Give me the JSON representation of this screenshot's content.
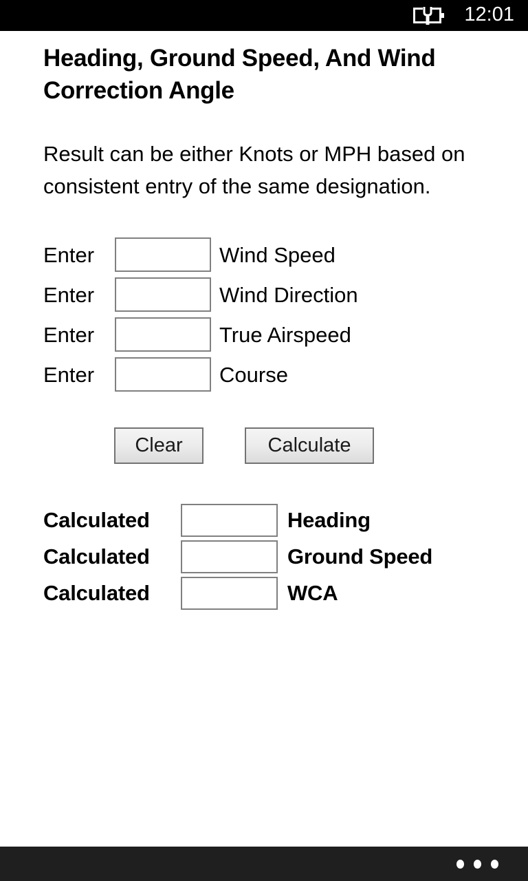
{
  "status_bar": {
    "battery_icon": "battery-charging-icon",
    "clock": "12:01",
    "background_color": "#000000"
  },
  "page": {
    "title": "Heading, Ground Speed, And Wind Correction Angle",
    "description": "Result can be either Knots or MPH based on consistent entry of the same designation.",
    "background_color": "#ffffff"
  },
  "inputs": {
    "rows": [
      {
        "prefix": "Enter",
        "value": "",
        "placeholder": "",
        "suffix": "Wind Speed"
      },
      {
        "prefix": "Enter",
        "value": "",
        "placeholder": "",
        "suffix": "Wind Direction"
      },
      {
        "prefix": "Enter",
        "value": "",
        "placeholder": "",
        "suffix": "True Airspeed"
      },
      {
        "prefix": "Enter",
        "value": "",
        "placeholder": "",
        "suffix": "Course"
      }
    ]
  },
  "buttons": {
    "clear_label": "Clear",
    "calculate_label": "Calculate"
  },
  "results": {
    "rows": [
      {
        "prefix": "Calculated",
        "value": "",
        "placeholder": "",
        "suffix": "Heading"
      },
      {
        "prefix": "Calculated",
        "value": "",
        "placeholder": "",
        "suffix": "Ground Speed"
      },
      {
        "prefix": "Calculated",
        "value": "",
        "placeholder": "",
        "suffix": "WCA"
      }
    ]
  },
  "nav_bar": {
    "more_icon": "ellipsis-icon",
    "background_color": "#1f1f1f"
  }
}
